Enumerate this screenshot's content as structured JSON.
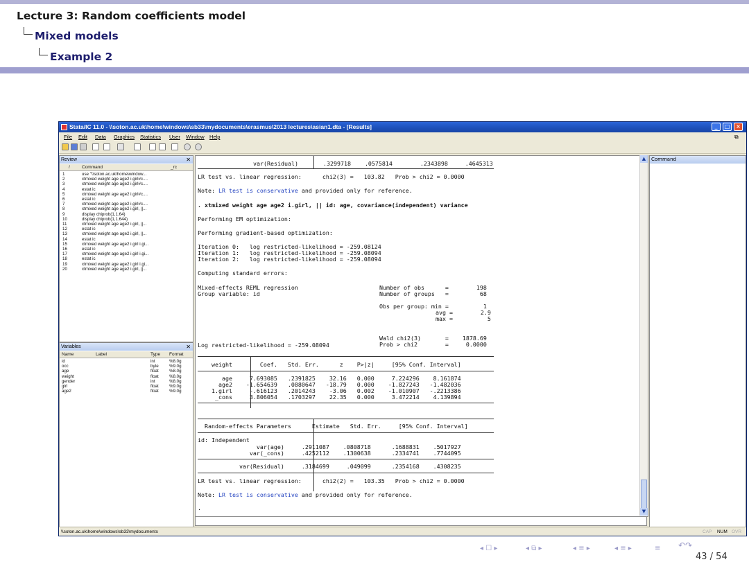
{
  "slide": {
    "breadcrumb": [
      "Lecture 3: Random coefficients model",
      "Mixed models",
      "Example 2"
    ],
    "page_number": "43 / 54"
  },
  "window": {
    "title": "Stata/IC 11.0 - \\\\soton.ac.uk\\home\\windows\\sb33\\mydocuments\\erasmus\\2013 lectures\\asian1.dta - [Results]",
    "menus": [
      "File",
      "Edit",
      "Data",
      "Graphics",
      "Statistics",
      "User",
      "Window",
      "Help"
    ]
  },
  "review": {
    "title": "Review",
    "col_command": "Command",
    "col_rc": "_rc",
    "items": [
      {
        "n": "1",
        "cmd": "use \"\\\\soton.ac.uk\\home\\window..."
      },
      {
        "n": "2",
        "cmd": "xtmixed weight age age2 i.girl#c...."
      },
      {
        "n": "3",
        "cmd": "xtmixed weight age age2 i.girl#c...."
      },
      {
        "n": "4",
        "cmd": "estat ic"
      },
      {
        "n": "5",
        "cmd": "xtmixed weight age age2 i.girl#c...."
      },
      {
        "n": "6",
        "cmd": "estat ic"
      },
      {
        "n": "7",
        "cmd": "xtmixed weight age age2 i.girl#c...."
      },
      {
        "n": "8",
        "cmd": "xtmixed weight age age2 i.girl, ||..."
      },
      {
        "n": "9",
        "cmd": "display chiprob(1,1.64)"
      },
      {
        "n": "10",
        "cmd": "display chiprob(1,1.644)"
      },
      {
        "n": "11",
        "cmd": "xtmixed weight age age2 i.girl, ||..."
      },
      {
        "n": "12",
        "cmd": "estat ic"
      },
      {
        "n": "13",
        "cmd": "xtmixed weight age age2 i.girl, ||..."
      },
      {
        "n": "14",
        "cmd": "estat ic"
      },
      {
        "n": "15",
        "cmd": "xtmixed weight age age2 i.girl i.gi..."
      },
      {
        "n": "16",
        "cmd": "estat ic"
      },
      {
        "n": "17",
        "cmd": "xtmixed weight age age2 i.girl i.gi..."
      },
      {
        "n": "18",
        "cmd": "estat ic"
      },
      {
        "n": "19",
        "cmd": "xtmixed weight age age2 i.girl i.gi..."
      },
      {
        "n": "20",
        "cmd": "xtmixed weight age age2 i.girl, ||..."
      }
    ]
  },
  "variables": {
    "title": "Variables",
    "col_name": "Name",
    "col_label": "Label",
    "col_type": "Type",
    "col_format": "Format",
    "items": [
      {
        "name": "id",
        "type": "int",
        "format": "%8.0g"
      },
      {
        "name": "occ",
        "type": "byte",
        "format": "%9.0g"
      },
      {
        "name": "age",
        "type": "float",
        "format": "%8.0g"
      },
      {
        "name": "weight",
        "type": "float",
        "format": "%8.0g"
      },
      {
        "name": "gender",
        "type": "int",
        "format": "%8.0g"
      },
      {
        "name": "girl",
        "type": "float",
        "format": "%9.0g"
      },
      {
        "name": "age2",
        "type": "float",
        "format": "%9.0g"
      }
    ]
  },
  "results": {
    "top_resid_label": "var(Residual)",
    "top_resid_vals": ".3299718    .0575814        .2343898     .4645313",
    "lr1": "LR test vs. linear regression:      chi2(3) =   103.82   Prob > chi2 = 0.0000",
    "note_prefix": "Note: ",
    "note_blue": "LR test is conservative",
    "note_suffix": " and provided only for reference.",
    "command": ". xtmixed weight age age2 i.girl, || id: age, covariance(independent) variance",
    "em": "Performing EM optimization:",
    "gradient": "Performing gradient-based optimization:",
    "iter0": "Iteration 0:   log restricted-likelihood = -259.08124",
    "iter1": "Iteration 1:   log restricted-likelihood = -259.08094",
    "iter2": "Iteration 2:   log restricted-likelihood = -259.08094",
    "computing": "Computing standard errors:",
    "model": "Mixed-effects REML regression",
    "groupvar": "Group variable: id",
    "nobs": "Number of obs      =        198",
    "ngroups": "Number of groups   =         68",
    "opg_min": "Obs per group: min =          1",
    "opg_avg": "avg =        2.9",
    "opg_max": "max =          5",
    "wald": "Wald chi2(3)       =    1878.69",
    "prob": "Prob > chi2        =     0.0000",
    "loglik": "Log restricted-likelihood = -259.08094",
    "fixed_header": "    weight        Coef.   Std. Err.      z    P>|z|     [95% Conf. Interval]",
    "fixed_rows": [
      "       age     7.693085   .2391825    32.16   0.000     7.224296    8.161874",
      "      age2    -1.654639   .0880647   -18.79   0.000    -1.827243   -1.482036",
      "    1.girl     -.616123   .2014243    -3.06   0.002    -1.010907   -.2213386",
      "     _cons     3.806054   .1703297    22.35   0.000     3.472214    4.139894"
    ],
    "random_header": "  Random-effects Parameters      Estimate   Std. Err.     [95% Conf. Interval]",
    "random_id": "id: Independent",
    "random_rows": [
      "                 var(age)     .2911087    .0808718      .1688831    .5017927",
      "               var(_cons)     .4252112    .1300638      .2334741    .7744095"
    ],
    "random_resid": "            var(Residual)     .3184699     .049099      .2354168    .4308235",
    "lr2": "LR test vs. linear regression:      chi2(2) =   103.35   Prob > chi2 = 0.0000",
    "cursor": "."
  },
  "command_panel": {
    "title": "Command"
  },
  "statusbar": {
    "path": "\\\\soton.ac.uk\\home\\windows\\sb33\\mydocuments",
    "cap": "CAP",
    "num": "NUM",
    "ovr": "OVR"
  },
  "colors": {
    "beamer_bar": "#9f9fcf",
    "titlebar": "#1d4fb8",
    "note_blue": "#1f3fbf"
  }
}
